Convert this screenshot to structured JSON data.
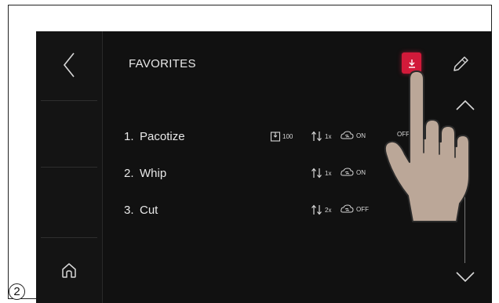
{
  "screen": {
    "title": "FAVORITES",
    "back_icon": "chevron-left-icon",
    "home_icon": "home-icon",
    "save_icon": "download-icon",
    "edit_icon": "pencil-icon",
    "scroll_up_icon": "chevron-up-icon",
    "scroll_down_icon": "chevron-down-icon",
    "accent_color": "#d21a3a"
  },
  "favorites": [
    {
      "num": "1.",
      "name": "Pacotize",
      "portions": "100",
      "repeat": "1x",
      "airflow": "ON",
      "option": "OFF"
    },
    {
      "num": "2.",
      "name": "Whip",
      "repeat": "1x",
      "airflow": "ON"
    },
    {
      "num": "3.",
      "name": "Cut",
      "repeat": "2x",
      "airflow": "OFF"
    }
  ],
  "figure": {
    "step_number": "2"
  }
}
